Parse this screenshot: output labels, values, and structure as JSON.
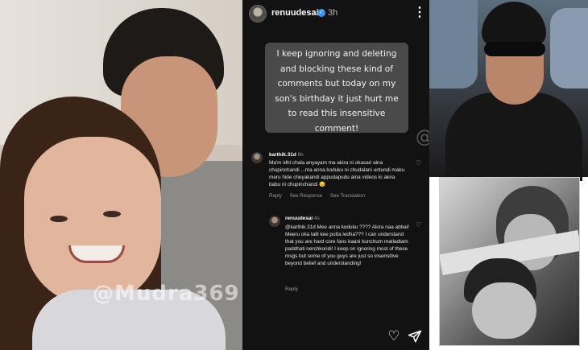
{
  "watermarks": {
    "left": "@Mudra369",
    "middle": "@Mudra369"
  },
  "post": {
    "username": "renuudesai",
    "time": "3h",
    "story_text": "I keep ignoring and deleting and blocking these kind of comments but today on my son's birthday it just hurt me to read this insensitive comment!"
  },
  "comments": [
    {
      "user": "karthik.31d",
      "time": "6h",
      "text": "Ma'm idhi chala anyayam ma akira ni okasari aina chupinchandi ...ma anna koduku ni chudalani untundi maku meru hide cheyakandi appudapudu aina videos lo akira babu ni chupinchandi 😔",
      "actions": [
        "Reply",
        "See Response",
        "See Translation"
      ]
    },
    {
      "user": "renuudesai",
      "time": "4s",
      "text": "@karthik.31d Mee anna koduku ???? Akira naa abbai! Meeru oka talli kee putta ledha??? I can understand that you are hard core fans kaani kunchum matladtam paddhati nerchkondi! I keep on ignoring most of these msgs but some of you guys are just so insensitive beyond belief and understanding!",
      "actions": [
        "Reply"
      ]
    }
  ],
  "colors": {
    "ig_background": "#121212",
    "story_box": "#4a4a4a",
    "verified": "#3897f0"
  }
}
